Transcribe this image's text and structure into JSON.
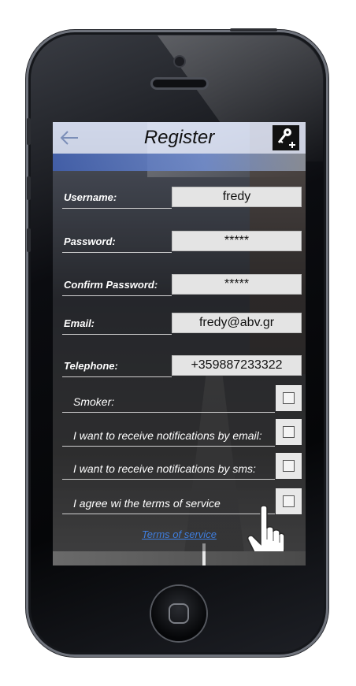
{
  "header": {
    "title": "Register",
    "back_icon": "back-arrow-icon",
    "add_user_icon": "key-plus-icon"
  },
  "form": {
    "username": {
      "label": "Username:",
      "value": "fredy"
    },
    "password": {
      "label": "Password:",
      "value": "*****"
    },
    "confirm_password": {
      "label": "Confirm Password:",
      "value": "*****"
    },
    "email": {
      "label": "Email:",
      "value": "fredy@abv.gr"
    },
    "telephone": {
      "label": "Telephone:",
      "value": "+359887233322"
    }
  },
  "options": [
    {
      "label": "Smoker:"
    },
    {
      "label": "I want to receive notifications by email:"
    },
    {
      "label": "I want to receive notifications by sms:"
    },
    {
      "label": "I agree wi the terms of service"
    }
  ],
  "footer": {
    "terms_link": "Terms of service"
  },
  "colors": {
    "link": "#3f7fe0",
    "header_bg": "#d7def0",
    "field_bg": "#e4e4e4"
  }
}
